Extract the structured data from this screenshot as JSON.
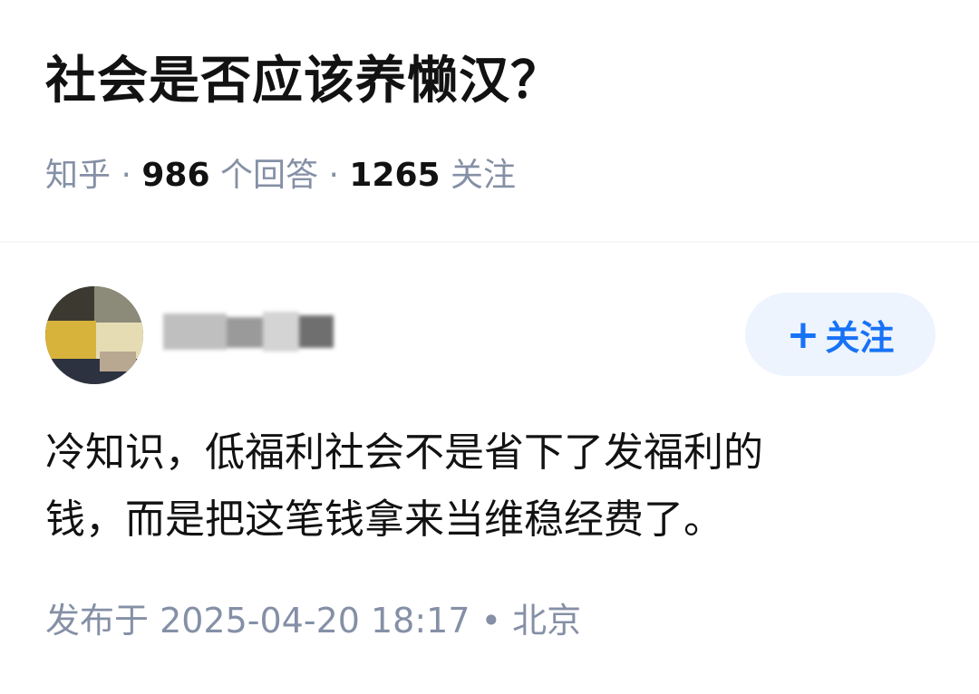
{
  "question": {
    "title": "社会是否应该养懒汉？",
    "source": "知乎",
    "separator": "·",
    "answer_count": "986",
    "answer_unit": "个回答",
    "follower_count": "1265",
    "follower_unit": "关注"
  },
  "answer": {
    "follow_button_plus": "+",
    "follow_button_label": "关注",
    "content_lines": [
      "冷知识，低福利社会不是省下了发福利的",
      "钱，而是把这笔钱拿来当维稳经费了。"
    ],
    "published_label": "发布于 2025-04-20 18:17",
    "location_separator": "•",
    "location": "北京"
  },
  "colors": {
    "title": "#121212",
    "meta_gray": "#8590a6",
    "accent_blue": "#1772f6",
    "follow_button_bg": "#eef4fd",
    "divider_gray": "#f6f6f6"
  }
}
